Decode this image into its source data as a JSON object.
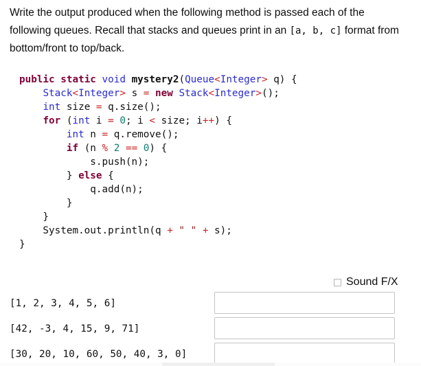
{
  "prompt": {
    "part1": "Write the output produced when the following method is passed each of the following queues. Recall that stacks and queues print in an ",
    "mono": "[a, b, c]",
    "part2": " format from bottom/front to top/back."
  },
  "code": {
    "lines": [
      [
        {
          "t": "public",
          "c": "kw"
        },
        {
          "t": " ",
          "c": "pln"
        },
        {
          "t": "static",
          "c": "kw"
        },
        {
          "t": " ",
          "c": "pln"
        },
        {
          "t": "void",
          "c": "typ"
        },
        {
          "t": " ",
          "c": "pln"
        },
        {
          "t": "mystery2",
          "c": "fn"
        },
        {
          "t": "(",
          "c": "pln"
        },
        {
          "t": "Queue",
          "c": "typ"
        },
        {
          "t": "<",
          "c": "op"
        },
        {
          "t": "Integer",
          "c": "typ"
        },
        {
          "t": ">",
          "c": "op"
        },
        {
          "t": " q) {",
          "c": "pln"
        }
      ],
      [
        {
          "t": "    ",
          "c": "pln"
        },
        {
          "t": "Stack",
          "c": "typ"
        },
        {
          "t": "<",
          "c": "op"
        },
        {
          "t": "Integer",
          "c": "typ"
        },
        {
          "t": ">",
          "c": "op"
        },
        {
          "t": " s ",
          "c": "pln"
        },
        {
          "t": "=",
          "c": "op"
        },
        {
          "t": " ",
          "c": "pln"
        },
        {
          "t": "new",
          "c": "kw"
        },
        {
          "t": " ",
          "c": "pln"
        },
        {
          "t": "Stack",
          "c": "typ"
        },
        {
          "t": "<",
          "c": "op"
        },
        {
          "t": "Integer",
          "c": "typ"
        },
        {
          "t": ">",
          "c": "op"
        },
        {
          "t": "();",
          "c": "pln"
        }
      ],
      [
        {
          "t": "    ",
          "c": "pln"
        },
        {
          "t": "int",
          "c": "typ"
        },
        {
          "t": " size ",
          "c": "pln"
        },
        {
          "t": "=",
          "c": "op"
        },
        {
          "t": " q.size();",
          "c": "pln"
        }
      ],
      [
        {
          "t": "    ",
          "c": "pln"
        },
        {
          "t": "for",
          "c": "kw"
        },
        {
          "t": " (",
          "c": "pln"
        },
        {
          "t": "int",
          "c": "typ"
        },
        {
          "t": " i ",
          "c": "pln"
        },
        {
          "t": "=",
          "c": "op"
        },
        {
          "t": " ",
          "c": "pln"
        },
        {
          "t": "0",
          "c": "num"
        },
        {
          "t": "; i ",
          "c": "pln"
        },
        {
          "t": "<",
          "c": "op"
        },
        {
          "t": " size; i",
          "c": "pln"
        },
        {
          "t": "++",
          "c": "op"
        },
        {
          "t": ") {",
          "c": "pln"
        }
      ],
      [
        {
          "t": "        ",
          "c": "pln"
        },
        {
          "t": "int",
          "c": "typ"
        },
        {
          "t": " n ",
          "c": "pln"
        },
        {
          "t": "=",
          "c": "op"
        },
        {
          "t": " q.remove();",
          "c": "pln"
        }
      ],
      [
        {
          "t": "        ",
          "c": "pln"
        },
        {
          "t": "if",
          "c": "kw"
        },
        {
          "t": " (n ",
          "c": "pln"
        },
        {
          "t": "%",
          "c": "op"
        },
        {
          "t": " ",
          "c": "pln"
        },
        {
          "t": "2",
          "c": "num"
        },
        {
          "t": " ",
          "c": "pln"
        },
        {
          "t": "==",
          "c": "op"
        },
        {
          "t": " ",
          "c": "pln"
        },
        {
          "t": "0",
          "c": "num"
        },
        {
          "t": ") {",
          "c": "pln"
        }
      ],
      [
        {
          "t": "            s.push(n);",
          "c": "pln"
        }
      ],
      [
        {
          "t": "        } ",
          "c": "pln"
        },
        {
          "t": "else",
          "c": "kw"
        },
        {
          "t": " {",
          "c": "pln"
        }
      ],
      [
        {
          "t": "            q.add(n);",
          "c": "pln"
        }
      ],
      [
        {
          "t": "        }",
          "c": "pln"
        }
      ],
      [
        {
          "t": "    }",
          "c": "pln"
        }
      ],
      [
        {
          "t": "    System.out.println(q ",
          "c": "pln"
        },
        {
          "t": "+",
          "c": "op"
        },
        {
          "t": " ",
          "c": "pln"
        },
        {
          "t": "\" \"",
          "c": "str"
        },
        {
          "t": " ",
          "c": "pln"
        },
        {
          "t": "+",
          "c": "op"
        },
        {
          "t": " s);",
          "c": "pln"
        }
      ],
      [
        {
          "t": "}",
          "c": "pln"
        }
      ]
    ]
  },
  "sound_fx": {
    "label": "Sound F/X",
    "checked": false
  },
  "answers": {
    "placeholder": "",
    "rows": [
      {
        "queue": "[1, 2, 3, 4, 5, 6]",
        "value": ""
      },
      {
        "queue": "[42, -3, 4, 15, 9, 71]",
        "value": ""
      },
      {
        "queue": "[30, 20, 10, 60, 50, 40, 3, 0]",
        "value": ""
      }
    ]
  },
  "colors": {
    "keyword": "#7f0037",
    "type": "#2a2ad0",
    "operator": "#cc2222",
    "number": "#0b7d6e",
    "string": "#8b1a1a",
    "text": "#101010",
    "input_border": "#c4c4c4",
    "checkbox_border": "#b5b5b5"
  }
}
